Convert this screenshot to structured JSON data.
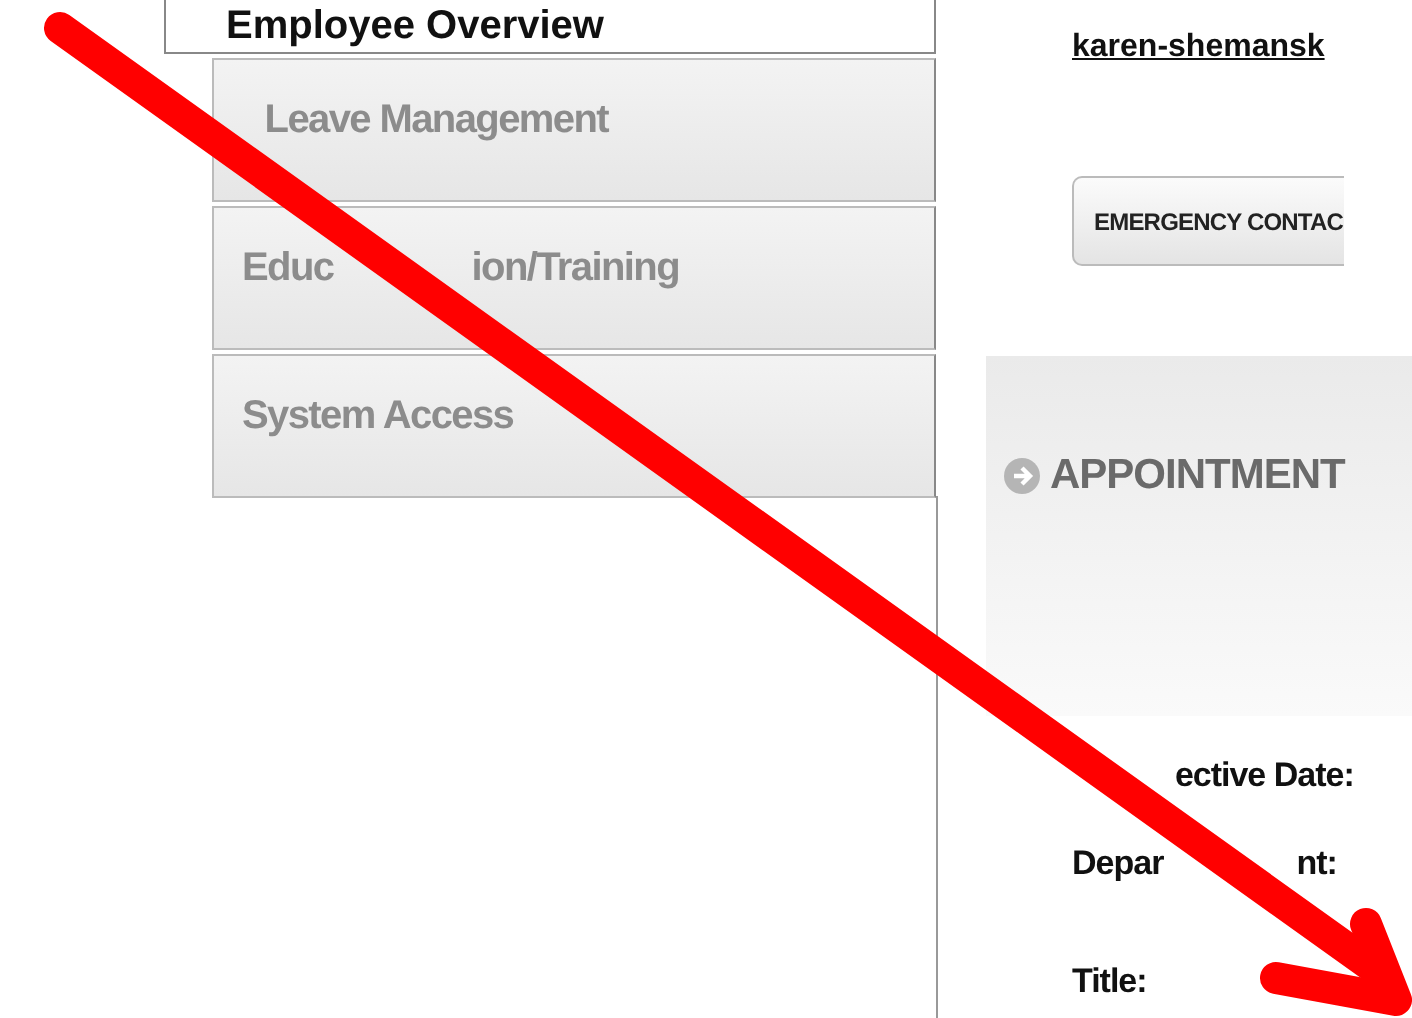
{
  "nav": {
    "items": [
      {
        "label": "Employee Overview",
        "selected": true
      },
      {
        "label": "Leave Management",
        "selected": false
      },
      {
        "label": [
          "Educ",
          "ion/Training"
        ],
        "selected": false
      },
      {
        "label": "System Access",
        "selected": false
      }
    ]
  },
  "user_link": "karen-shemansk",
  "buttons": [
    {
      "label": "EMERGENCY CONTAC"
    }
  ],
  "section": {
    "title": "APPOINTMENT",
    "fields": [
      {
        "label": [
          "ective Date:"
        ]
      },
      {
        "label": [
          "Depar",
          "nt:"
        ]
      },
      {
        "label": [
          "Title:"
        ]
      }
    ]
  }
}
